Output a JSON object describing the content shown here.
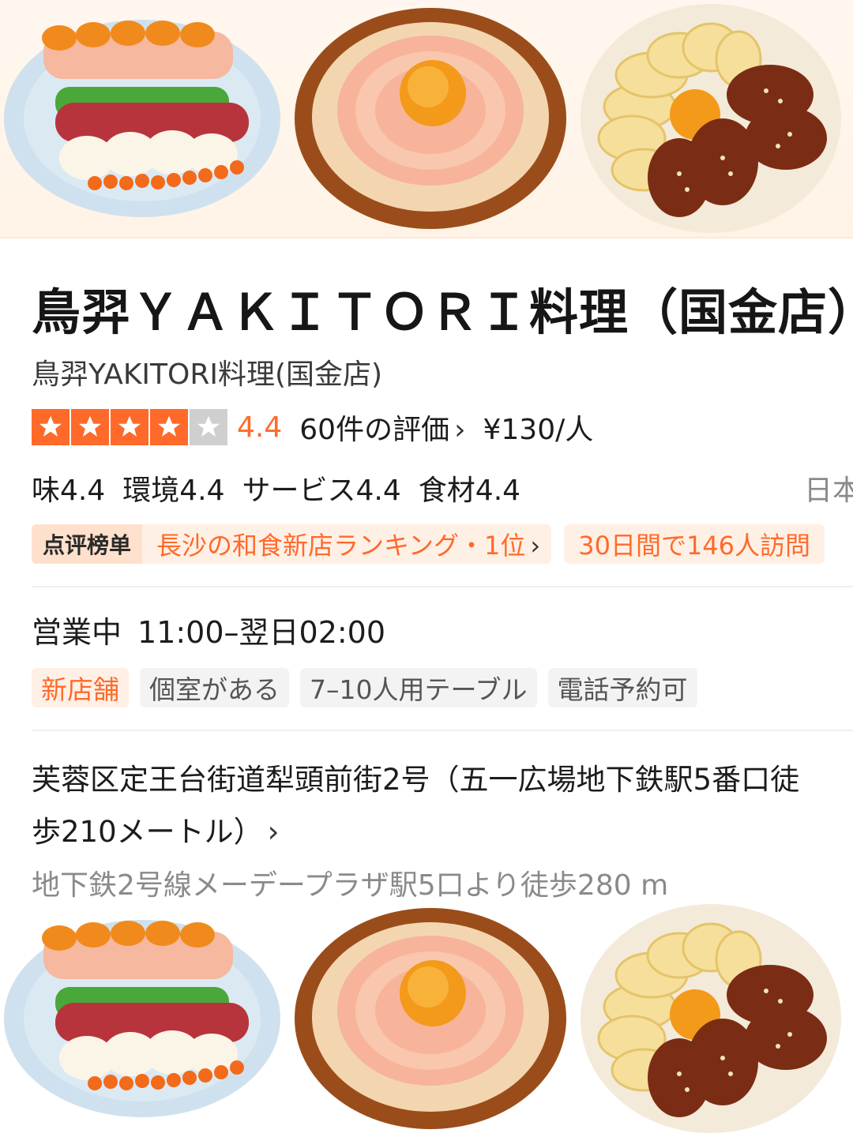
{
  "restaurant": {
    "title": "鳥羿ＹＡＫＩＴＯＲＩ料理（国金店）",
    "subtitle": "鳥羿YAKITORI料理(国金店)",
    "rating": {
      "stars": 4,
      "max_stars": 5,
      "score": "4.4",
      "reviews": "60件の評価",
      "price": "¥130/人"
    },
    "subscores": [
      "味4.4",
      "環境4.4",
      "サービス4.4",
      "食材4.4"
    ],
    "cuisine": "日本",
    "ranking": {
      "brand": "点评榜单",
      "text": "長沙の和食新店ランキング・1位",
      "visits": "30日間で146人訪問"
    },
    "hours": {
      "status": "営業中",
      "time": "11:00–翌日02:00"
    },
    "tags": [
      "新店舗",
      "個室がある",
      "7–10人用テーブル",
      "電話予約可"
    ],
    "address": "芙蓉区定王台街道犁頭前街2号（五一広場地下鉄駅5番口徒歩210メートル）",
    "station": "地下鉄2号線メーデープラザ駅5口より徒歩280 m"
  },
  "colors": {
    "accent": "#ff6a2a",
    "badge_bg": "#fff0e6",
    "tag_bg": "#f3f3f3"
  },
  "icons": {
    "star": "star-icon",
    "chevron": "chevron-right-icon"
  },
  "images": [
    "sushi-platter-image",
    "shrimp-egg-bowl-image",
    "apple-glazed-meat-image"
  ]
}
